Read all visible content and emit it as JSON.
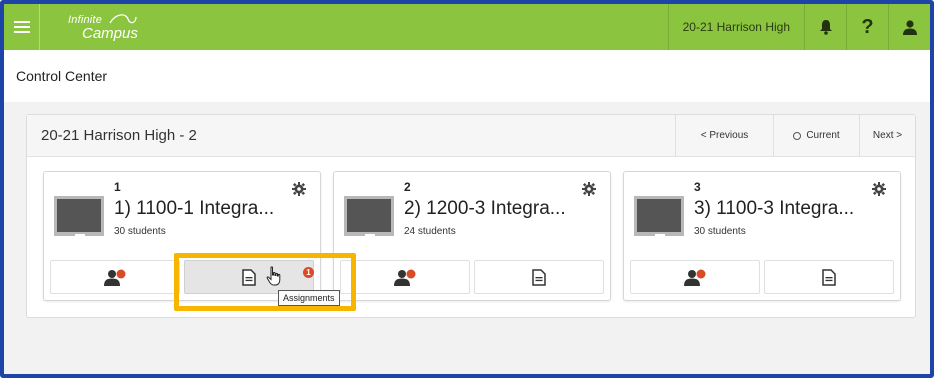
{
  "app": {
    "logo_line1": "Infinite",
    "logo_line2": "Campus",
    "school": "20-21 Harrison High",
    "accent_color": "#8bc540",
    "highlight_color": "#f7b500"
  },
  "header": {
    "title": "Control Center"
  },
  "panel": {
    "title": "20-21 Harrison High - 2",
    "prev_label": "< Previous",
    "current_label": "Current",
    "next_label": "Next >"
  },
  "cards": [
    {
      "period": "1",
      "name": "1) 1100-1 Integra...",
      "count": "30 students",
      "assignments_badge": "1"
    },
    {
      "period": "2",
      "name": "2) 1200-3 Integra...",
      "count": "24 students"
    },
    {
      "period": "3",
      "name": "3) 1100-3 Integra...",
      "count": "30 students"
    }
  ],
  "tooltip": "Assignments",
  "icons": [
    "menu-icon",
    "bell-icon",
    "help-icon",
    "user-icon",
    "gear-icon",
    "roster-icon",
    "assignments-icon",
    "pointer-cursor-icon"
  ]
}
